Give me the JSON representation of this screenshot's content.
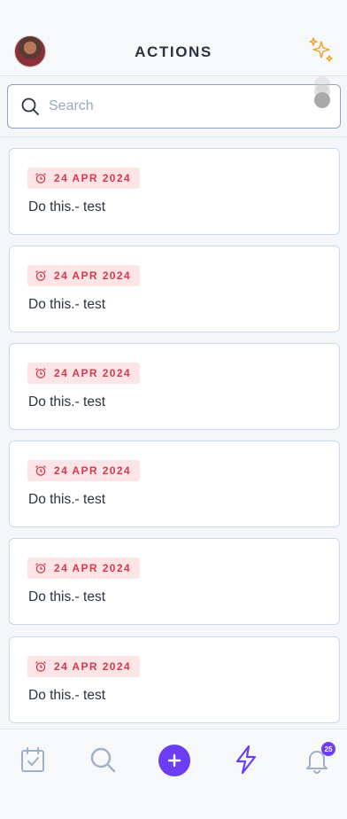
{
  "header": {
    "title": "ACTIONS",
    "avatar_icon": "user-avatar",
    "right_icon": "sparkles-icon"
  },
  "search": {
    "placeholder": "Search",
    "value": ""
  },
  "actions": [
    {
      "date": "24 APR 2024",
      "title": "Do this.- test"
    },
    {
      "date": "24 APR 2024",
      "title": "Do this.- test"
    },
    {
      "date": "24 APR 2024",
      "title": "Do this.- test"
    },
    {
      "date": "24 APR 2024",
      "title": "Do this.- test"
    },
    {
      "date": "24 APR 2024",
      "title": "Do this.- test"
    },
    {
      "date": "24 APR 2024",
      "title": "Do this.- test"
    }
  ],
  "bottom_nav": {
    "items": [
      "tasks-icon",
      "search-icon",
      "add-icon",
      "lightning-icon",
      "bell-icon"
    ],
    "notification_count": "25"
  },
  "colors": {
    "accent": "#6b3df5",
    "badge_bg": "#fde5e7",
    "badge_text": "#d43a4c",
    "card_border": "#c9d9ec"
  }
}
